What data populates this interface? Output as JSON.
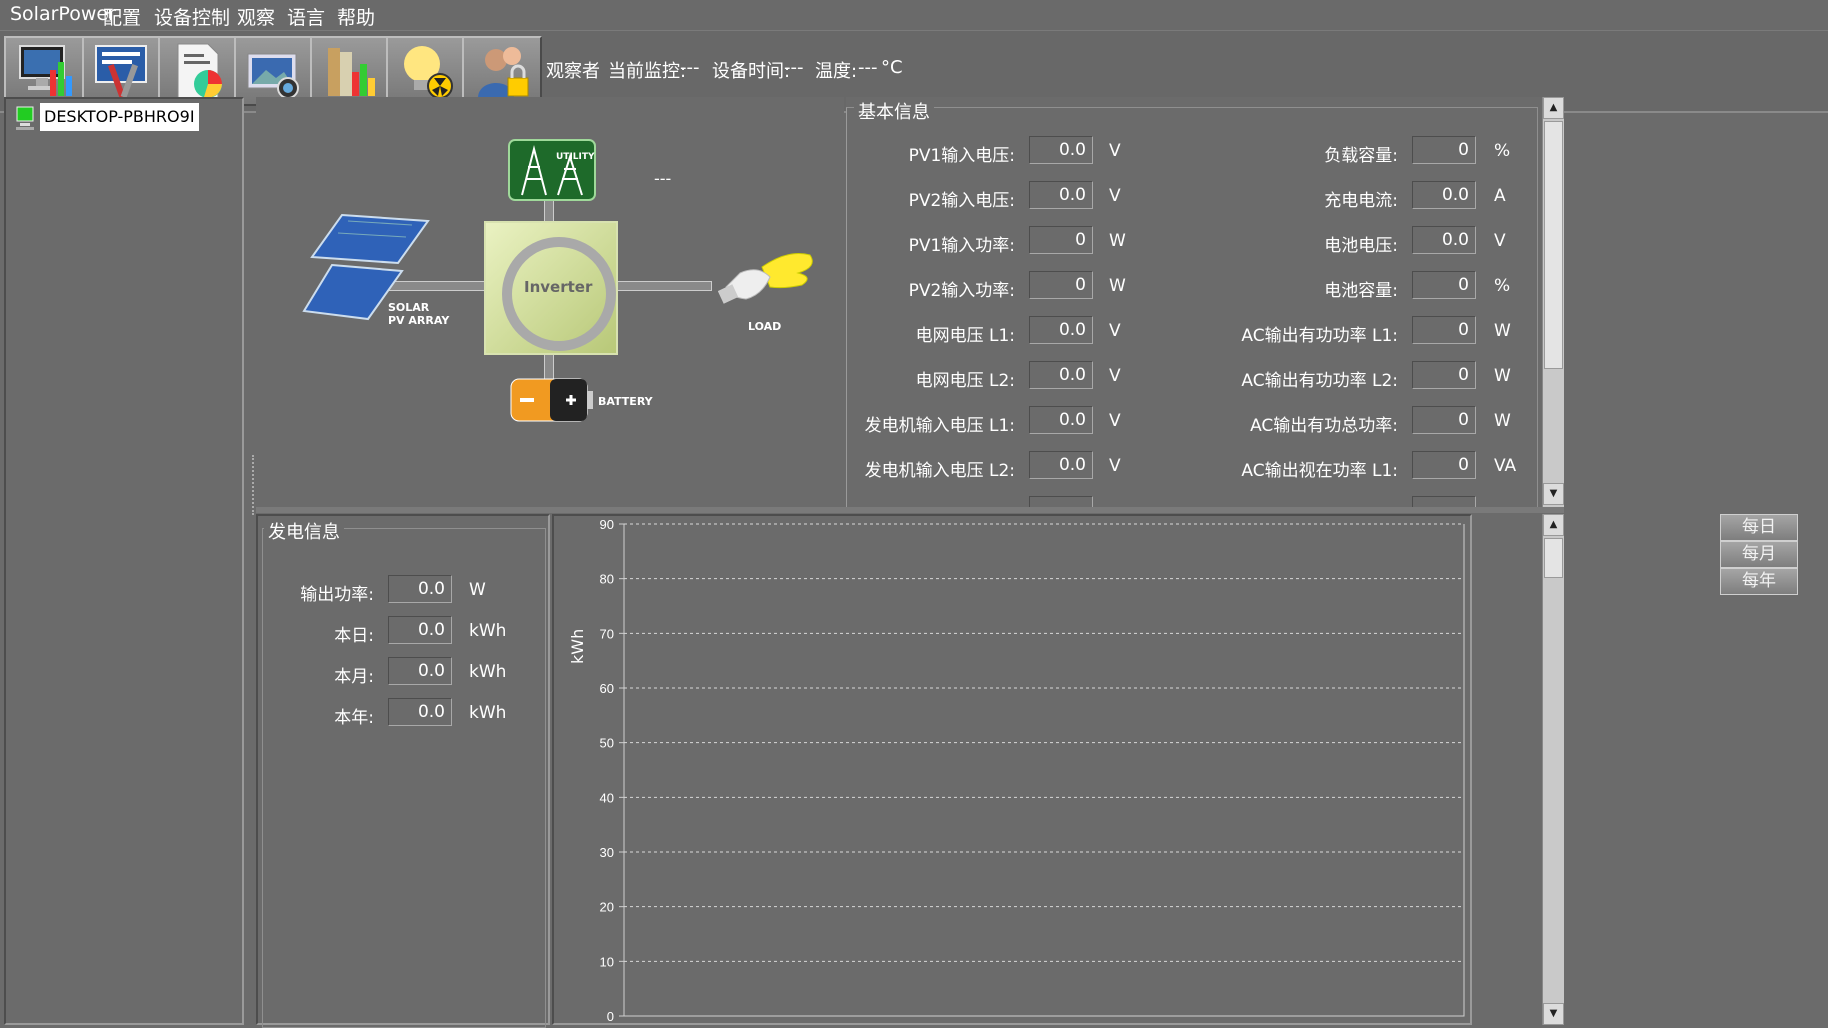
{
  "menu": {
    "app_name": "SolarPower",
    "items": [
      "配置",
      "设备控制",
      "观察",
      "语言",
      "帮助"
    ]
  },
  "toolbar": {
    "buttons": [
      "monitor-icon",
      "tools-icon",
      "report-icon",
      "camera-icon",
      "books-icon",
      "bulb-icon",
      "user-lock-icon"
    ],
    "status": {
      "role": "观察者",
      "monitor_label": "当前监控:",
      "monitor_value": "---",
      "time_label": "设备时间:",
      "time_value": "---",
      "temp_label": "温度:",
      "temp_value": "---",
      "temp_unit": "°C"
    }
  },
  "tree": {
    "device_name": "DESKTOP-PBHRO9I"
  },
  "diagram": {
    "utility_label": "UTILITY",
    "utility_status": "---",
    "solar_label_1": "SOLAR",
    "solar_label_2": "PV ARRAY",
    "inverter_label": "Inverter",
    "load_label": "LOAD",
    "battery_label": "BATTERY"
  },
  "basic_info": {
    "title": "基本信息",
    "left": [
      {
        "label": "PV1输入电压:",
        "value": "0.0",
        "unit": "V"
      },
      {
        "label": "PV2输入电压:",
        "value": "0.0",
        "unit": "V"
      },
      {
        "label": "PV1输入功率:",
        "value": "0",
        "unit": "W"
      },
      {
        "label": "PV2输入功率:",
        "value": "0",
        "unit": "W"
      },
      {
        "label": "电网电压 L1:",
        "value": "0.0",
        "unit": "V"
      },
      {
        "label": "电网电压 L2:",
        "value": "0.0",
        "unit": "V"
      },
      {
        "label": "发电机输入电压 L1:",
        "value": "0.0",
        "unit": "V"
      },
      {
        "label": "发电机输入电压 L2:",
        "value": "0.0",
        "unit": "V"
      }
    ],
    "right": [
      {
        "label": "负载容量:",
        "value": "0",
        "unit": "%"
      },
      {
        "label": "充电电流:",
        "value": "0.0",
        "unit": "A"
      },
      {
        "label": "电池电压:",
        "value": "0.0",
        "unit": "V"
      },
      {
        "label": "电池容量:",
        "value": "0",
        "unit": "%"
      },
      {
        "label": "AC输出有功功率 L1:",
        "value": "0",
        "unit": "W"
      },
      {
        "label": "AC输出有功功率 L2:",
        "value": "0",
        "unit": "W"
      },
      {
        "label": "AC输出有功总功率:",
        "value": "0",
        "unit": "W"
      },
      {
        "label": "AC输出视在功率 L1:",
        "value": "0",
        "unit": "VA"
      }
    ]
  },
  "generation_info": {
    "title": "发电信息",
    "rows": [
      {
        "label": "输出功率:",
        "value": "0.0",
        "unit": "W"
      },
      {
        "label": "本日:",
        "value": "0.0",
        "unit": "kWh"
      },
      {
        "label": "本月:",
        "value": "0.0",
        "unit": "kWh"
      },
      {
        "label": "本年:",
        "value": "0.0",
        "unit": "kWh"
      }
    ]
  },
  "period_buttons": [
    "每日",
    "每月",
    "每年"
  ],
  "chart_data": {
    "type": "bar",
    "ylabel": "kWh",
    "ylim": [
      0,
      90
    ],
    "yticks": [
      "0",
      "10",
      "20",
      "30",
      "40",
      "50",
      "60",
      "70",
      "80",
      "90"
    ],
    "grid": true,
    "categories": [],
    "values": []
  }
}
